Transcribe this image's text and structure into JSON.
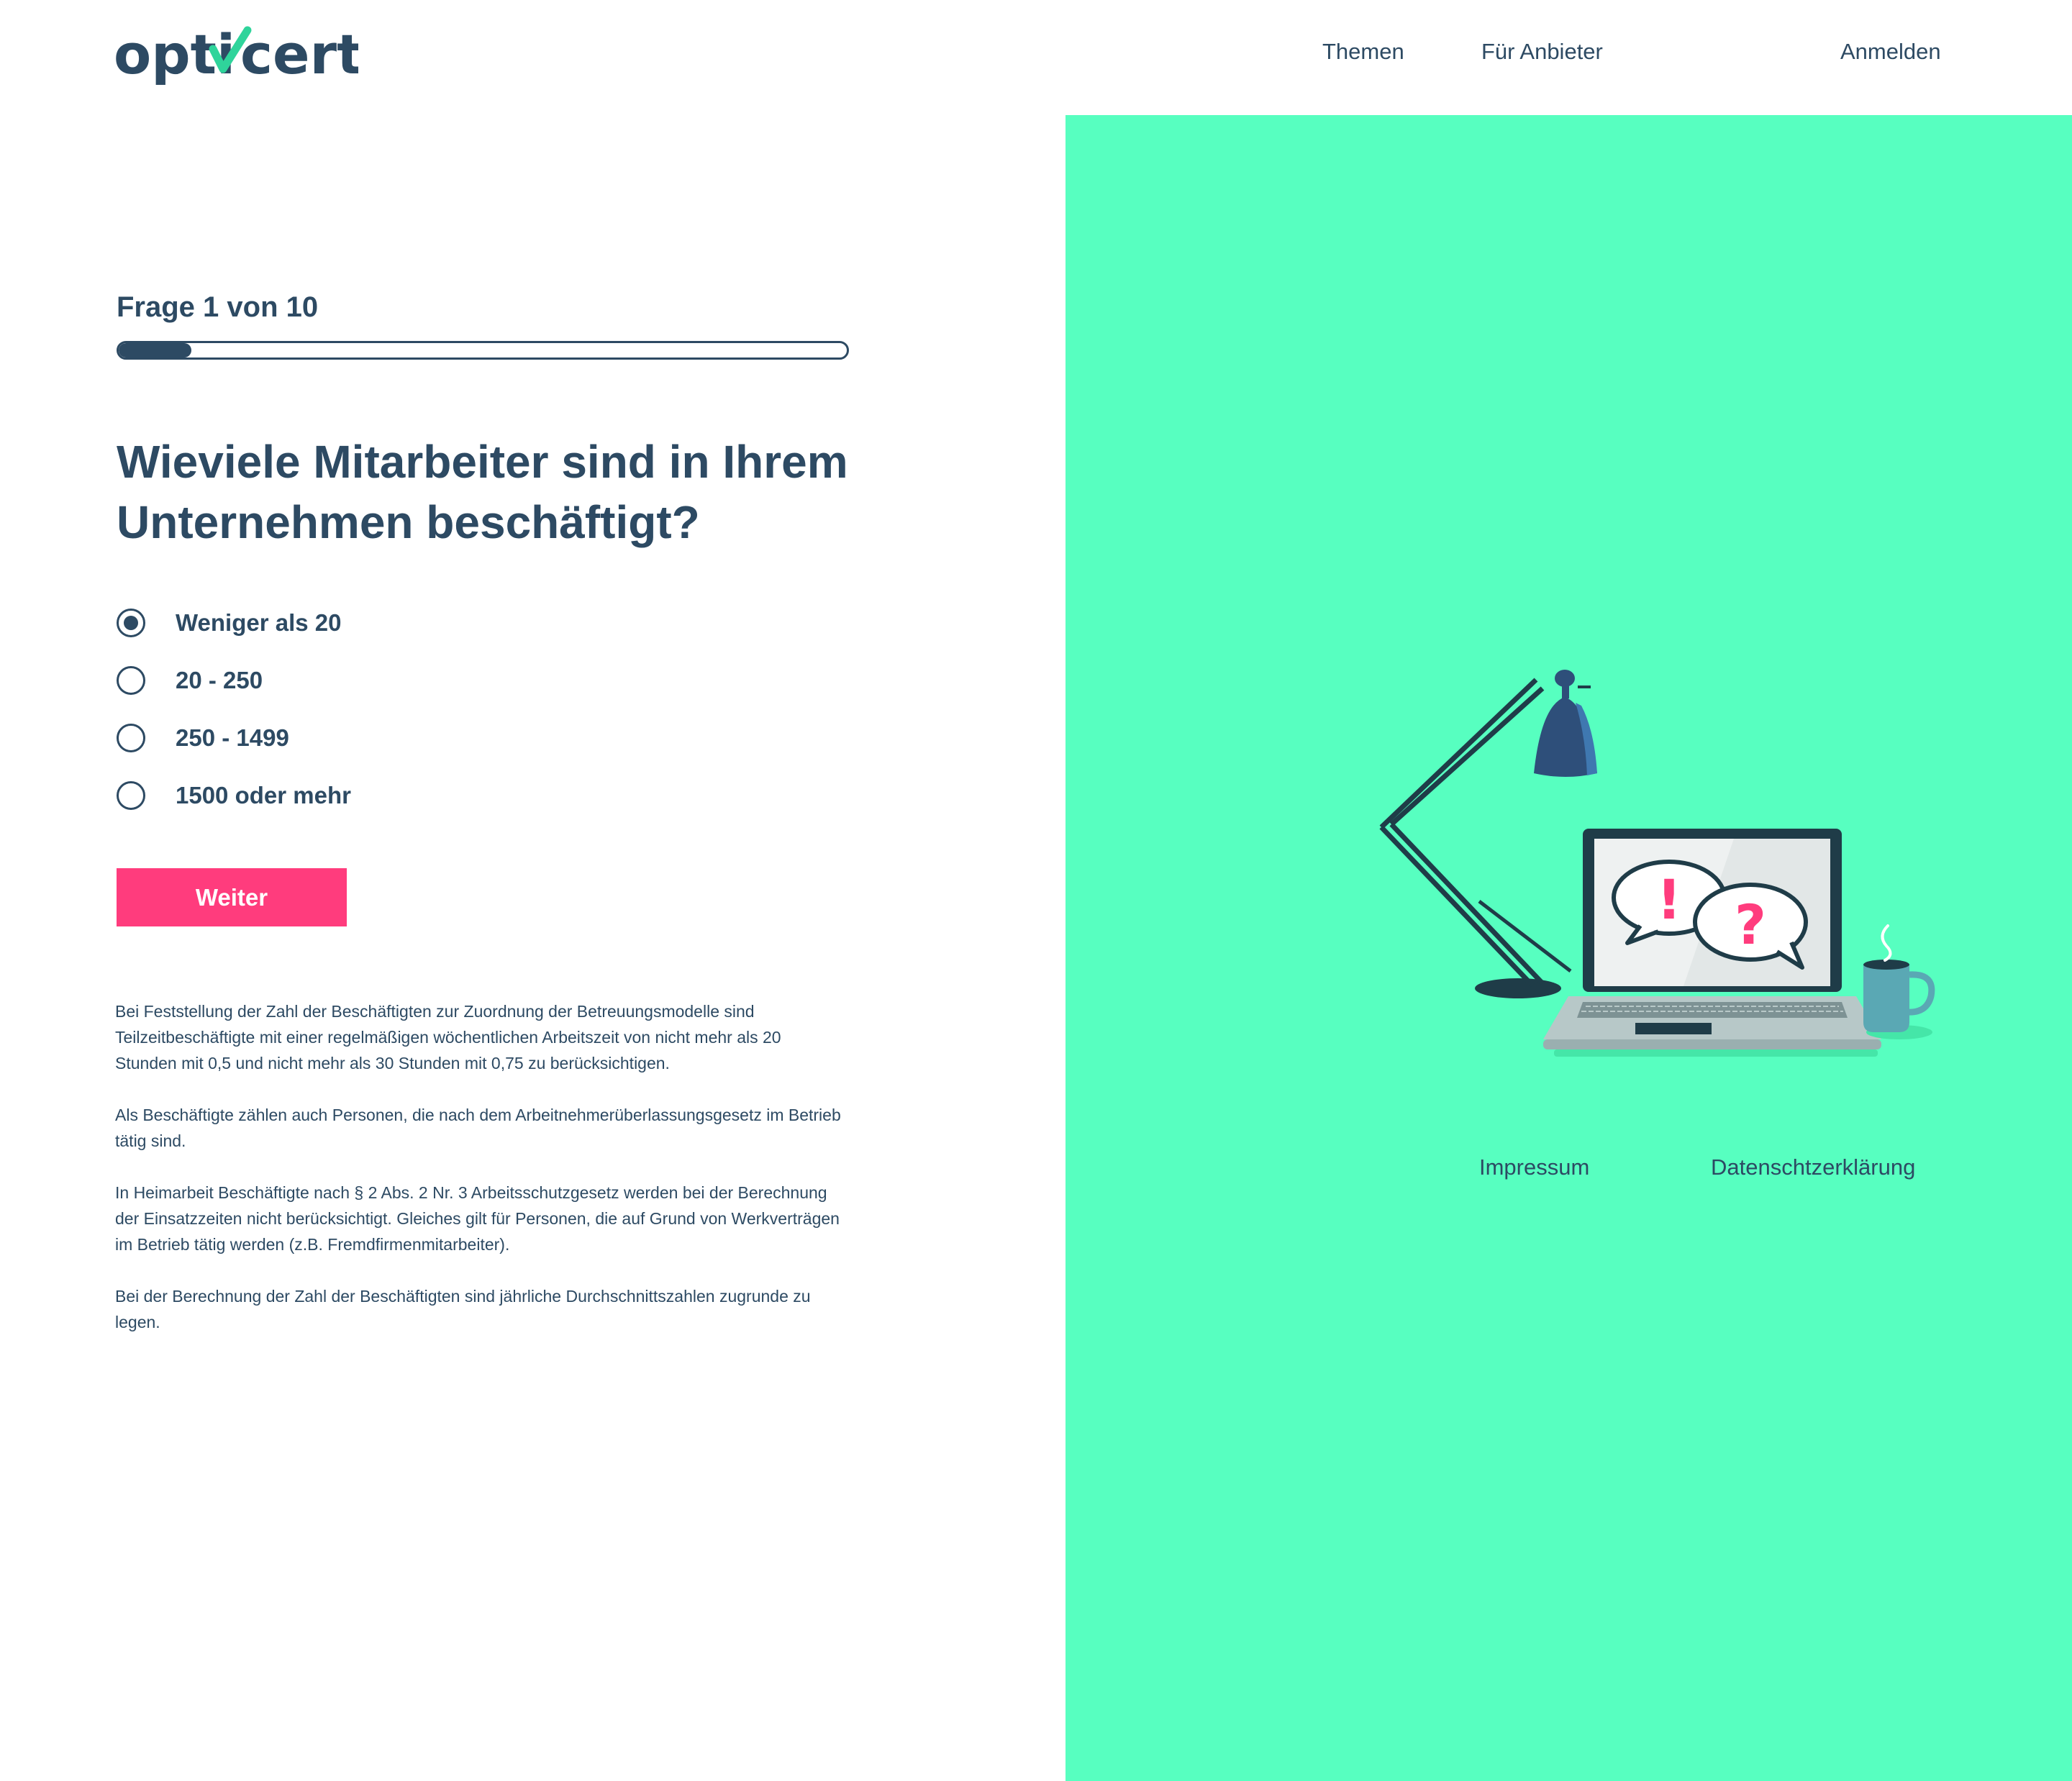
{
  "header": {
    "logo": {
      "before": "opti",
      "after": "cert",
      "icon": "check-mark"
    },
    "nav": [
      {
        "label": "Themen"
      },
      {
        "label": "Für Anbieter"
      },
      {
        "label": "Anmelden"
      }
    ]
  },
  "quiz": {
    "progress_label": "Frage 1 von 10",
    "progress": {
      "current": 1,
      "total": 10
    },
    "question": "Wieviele Mitarbeiter sind in Ihrem Unternehmen beschäftigt?",
    "options": [
      {
        "label": "Weniger als 20",
        "selected": true
      },
      {
        "label": "20 - 250",
        "selected": false
      },
      {
        "label": "250 - 1499",
        "selected": false
      },
      {
        "label": "1500 oder mehr",
        "selected": false
      }
    ],
    "submit_label": "Weiter"
  },
  "info": {
    "paragraphs": [
      "Bei Feststellung der Zahl der Beschäftigten zur Zuordnung der Betreuungsmodelle sind Teilzeitbeschäftigte mit einer regelmäßigen wöchentlichen Arbeitszeit von nicht mehr als 20 Stunden mit 0,5 und nicht mehr als 30 Stunden mit 0,75 zu berücksichtigen.",
      "Als Beschäftigte zählen auch Personen, die nach dem Arbeitnehmerüberlassungsgesetz im Betrieb tätig sind.",
      "In Heimarbeit Beschäftigte nach § 2 Abs. 2 Nr. 3 Arbeitsschutzgesetz werden bei der Berechnung der Einsatzzeiten nicht berücksichtigt. Gleiches gilt für Personen, die auf Grund von Werkverträgen im Betrieb tätig werden (z.B. Fremdfirmenmitarbeiter).",
      "Bei der Berechnung der Zahl der Beschäftigten sind jährliche Durchschnittszahlen zugrunde zu legen."
    ]
  },
  "illustration": {
    "icons": [
      "desk-lamp-icon",
      "laptop-icon",
      "exclamation-bubble-icon",
      "question-bubble-icon",
      "coffee-mug-icon"
    ],
    "bubble_marks": {
      "exclamation": "!",
      "question": "?"
    }
  },
  "footer": {
    "links": [
      {
        "label": "Impressum"
      },
      {
        "label": "Datenschtzerklärung"
      }
    ]
  },
  "colors": {
    "navy": "#2d4a63",
    "mint": "#57ffc0",
    "pink": "#ff3c7d",
    "check_green": "#2fd49b",
    "lamp_blue": "#2e4f7a"
  }
}
